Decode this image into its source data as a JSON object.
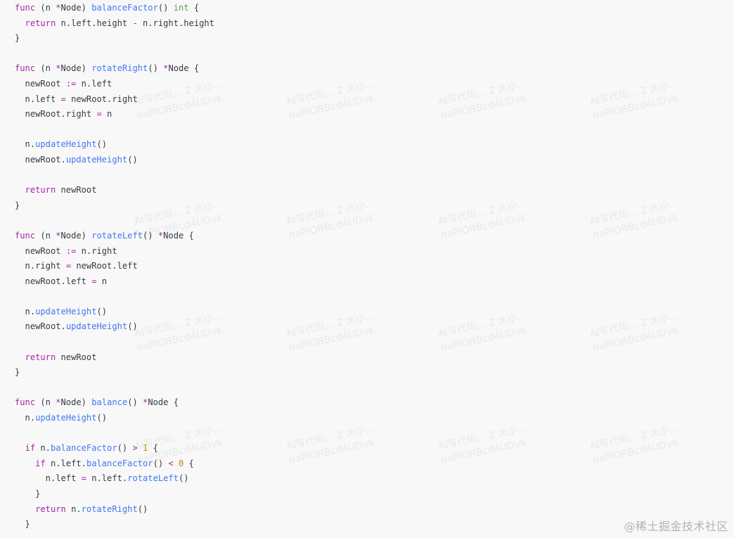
{
  "site_watermark": "@稀土掘金技术社区",
  "background_watermark": {
    "line1": "AI写代码... 2 大小...",
    "line2": "naPIORBcd4UDvk"
  },
  "code_lines": [
    [
      {
        "t": "func",
        "c": "kw"
      },
      {
        "t": " (n ",
        "c": "plain"
      },
      {
        "t": "*",
        "c": "op"
      },
      {
        "t": "Node) ",
        "c": "plain"
      },
      {
        "t": "balanceFactor",
        "c": "fn"
      },
      {
        "t": "() ",
        "c": "plain"
      },
      {
        "t": "int",
        "c": "type"
      },
      {
        "t": " {",
        "c": "plain"
      }
    ],
    [
      {
        "t": "  ",
        "c": "plain"
      },
      {
        "t": "return",
        "c": "kw"
      },
      {
        "t": " n.left.height ",
        "c": "plain"
      },
      {
        "t": "-",
        "c": "op"
      },
      {
        "t": " n.right.height",
        "c": "plain"
      }
    ],
    [
      {
        "t": "}",
        "c": "plain"
      }
    ],
    [],
    [
      {
        "t": "func",
        "c": "kw"
      },
      {
        "t": " (n ",
        "c": "plain"
      },
      {
        "t": "*",
        "c": "op"
      },
      {
        "t": "Node) ",
        "c": "plain"
      },
      {
        "t": "rotateRight",
        "c": "fn"
      },
      {
        "t": "() ",
        "c": "plain"
      },
      {
        "t": "*",
        "c": "op"
      },
      {
        "t": "Node {",
        "c": "plain"
      }
    ],
    [
      {
        "t": "  newRoot ",
        "c": "plain"
      },
      {
        "t": ":=",
        "c": "op"
      },
      {
        "t": " n.left",
        "c": "plain"
      }
    ],
    [
      {
        "t": "  n.left ",
        "c": "plain"
      },
      {
        "t": "=",
        "c": "op"
      },
      {
        "t": " newRoot.right",
        "c": "plain"
      }
    ],
    [
      {
        "t": "  newRoot.right ",
        "c": "plain"
      },
      {
        "t": "=",
        "c": "op"
      },
      {
        "t": " n",
        "c": "plain"
      }
    ],
    [],
    [
      {
        "t": "  n.",
        "c": "plain"
      },
      {
        "t": "updateHeight",
        "c": "fn"
      },
      {
        "t": "()",
        "c": "plain"
      }
    ],
    [
      {
        "t": "  newRoot.",
        "c": "plain"
      },
      {
        "t": "updateHeight",
        "c": "fn"
      },
      {
        "t": "()",
        "c": "plain"
      }
    ],
    [],
    [
      {
        "t": "  ",
        "c": "plain"
      },
      {
        "t": "return",
        "c": "kw"
      },
      {
        "t": " newRoot",
        "c": "plain"
      }
    ],
    [
      {
        "t": "}",
        "c": "plain"
      }
    ],
    [],
    [
      {
        "t": "func",
        "c": "kw"
      },
      {
        "t": " (n ",
        "c": "plain"
      },
      {
        "t": "*",
        "c": "op"
      },
      {
        "t": "Node) ",
        "c": "plain"
      },
      {
        "t": "rotateLeft",
        "c": "fn"
      },
      {
        "t": "() ",
        "c": "plain"
      },
      {
        "t": "*",
        "c": "op"
      },
      {
        "t": "Node {",
        "c": "plain"
      }
    ],
    [
      {
        "t": "  newRoot ",
        "c": "plain"
      },
      {
        "t": ":=",
        "c": "op"
      },
      {
        "t": " n.right",
        "c": "plain"
      }
    ],
    [
      {
        "t": "  n.right ",
        "c": "plain"
      },
      {
        "t": "=",
        "c": "op"
      },
      {
        "t": " newRoot.left",
        "c": "plain"
      }
    ],
    [
      {
        "t": "  newRoot.left ",
        "c": "plain"
      },
      {
        "t": "=",
        "c": "op"
      },
      {
        "t": " n",
        "c": "plain"
      }
    ],
    [],
    [
      {
        "t": "  n.",
        "c": "plain"
      },
      {
        "t": "updateHeight",
        "c": "fn"
      },
      {
        "t": "()",
        "c": "plain"
      }
    ],
    [
      {
        "t": "  newRoot.",
        "c": "plain"
      },
      {
        "t": "updateHeight",
        "c": "fn"
      },
      {
        "t": "()",
        "c": "plain"
      }
    ],
    [],
    [
      {
        "t": "  ",
        "c": "plain"
      },
      {
        "t": "return",
        "c": "kw"
      },
      {
        "t": " newRoot",
        "c": "plain"
      }
    ],
    [
      {
        "t": "}",
        "c": "plain"
      }
    ],
    [],
    [
      {
        "t": "func",
        "c": "kw"
      },
      {
        "t": " (n ",
        "c": "plain"
      },
      {
        "t": "*",
        "c": "op"
      },
      {
        "t": "Node) ",
        "c": "plain"
      },
      {
        "t": "balance",
        "c": "fn"
      },
      {
        "t": "() ",
        "c": "plain"
      },
      {
        "t": "*",
        "c": "op"
      },
      {
        "t": "Node {",
        "c": "plain"
      }
    ],
    [
      {
        "t": "  n.",
        "c": "plain"
      },
      {
        "t": "updateHeight",
        "c": "fn"
      },
      {
        "t": "()",
        "c": "plain"
      }
    ],
    [],
    [
      {
        "t": "  ",
        "c": "plain"
      },
      {
        "t": "if",
        "c": "kw"
      },
      {
        "t": " n.",
        "c": "plain"
      },
      {
        "t": "balanceFactor",
        "c": "fn"
      },
      {
        "t": "() ",
        "c": "plain"
      },
      {
        "t": ">",
        "c": "op"
      },
      {
        "t": " ",
        "c": "plain"
      },
      {
        "t": "1",
        "c": "num"
      },
      {
        "t": " {",
        "c": "plain"
      }
    ],
    [
      {
        "t": "    ",
        "c": "plain"
      },
      {
        "t": "if",
        "c": "kw"
      },
      {
        "t": " n.left.",
        "c": "plain"
      },
      {
        "t": "balanceFactor",
        "c": "fn"
      },
      {
        "t": "() ",
        "c": "plain"
      },
      {
        "t": "<",
        "c": "op"
      },
      {
        "t": " ",
        "c": "plain"
      },
      {
        "t": "0",
        "c": "num"
      },
      {
        "t": " {",
        "c": "plain"
      }
    ],
    [
      {
        "t": "      n.left ",
        "c": "plain"
      },
      {
        "t": "=",
        "c": "op"
      },
      {
        "t": " n.left.",
        "c": "plain"
      },
      {
        "t": "rotateLeft",
        "c": "fn"
      },
      {
        "t": "()",
        "c": "plain"
      }
    ],
    [
      {
        "t": "    }",
        "c": "plain"
      }
    ],
    [
      {
        "t": "    ",
        "c": "plain"
      },
      {
        "t": "return",
        "c": "kw"
      },
      {
        "t": " n.",
        "c": "plain"
      },
      {
        "t": "rotateRight",
        "c": "fn"
      },
      {
        "t": "()",
        "c": "plain"
      }
    ],
    [
      {
        "t": "  }",
        "c": "plain"
      }
    ]
  ],
  "colors": {
    "background": "#f8f8f8",
    "keyword": "#a626a4",
    "function": "#4078f2",
    "type": "#50a14f",
    "number": "#c18401",
    "text": "#383a42"
  }
}
